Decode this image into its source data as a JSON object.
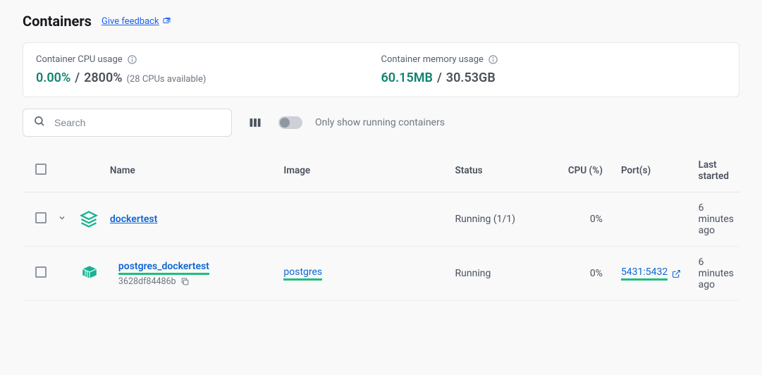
{
  "header": {
    "title": "Containers",
    "feedback": "Give feedback"
  },
  "stats": {
    "cpu": {
      "label": "Container CPU usage",
      "used": "0.00%",
      "total": "2800%",
      "extra": "(28 CPUs available)"
    },
    "mem": {
      "label": "Container memory usage",
      "used": "60.15MB",
      "total": "30.53GB"
    }
  },
  "toolbar": {
    "search_placeholder": "Search",
    "toggle_label": "Only show running containers"
  },
  "table": {
    "headers": {
      "name": "Name",
      "image": "Image",
      "status": "Status",
      "cpu": "CPU (%)",
      "ports": "Port(s)",
      "last": "Last started"
    },
    "rows": [
      {
        "type": "group",
        "name": "dockertest",
        "status": "Running (1/1)",
        "cpu": "0%",
        "last": "6 minutes ago"
      },
      {
        "type": "container",
        "name": "postgres_dockertest",
        "id": "3628df84486b",
        "image": "postgres",
        "status": "Running",
        "cpu": "0%",
        "port": "5431:5432",
        "last": "6 minutes ago"
      }
    ]
  }
}
